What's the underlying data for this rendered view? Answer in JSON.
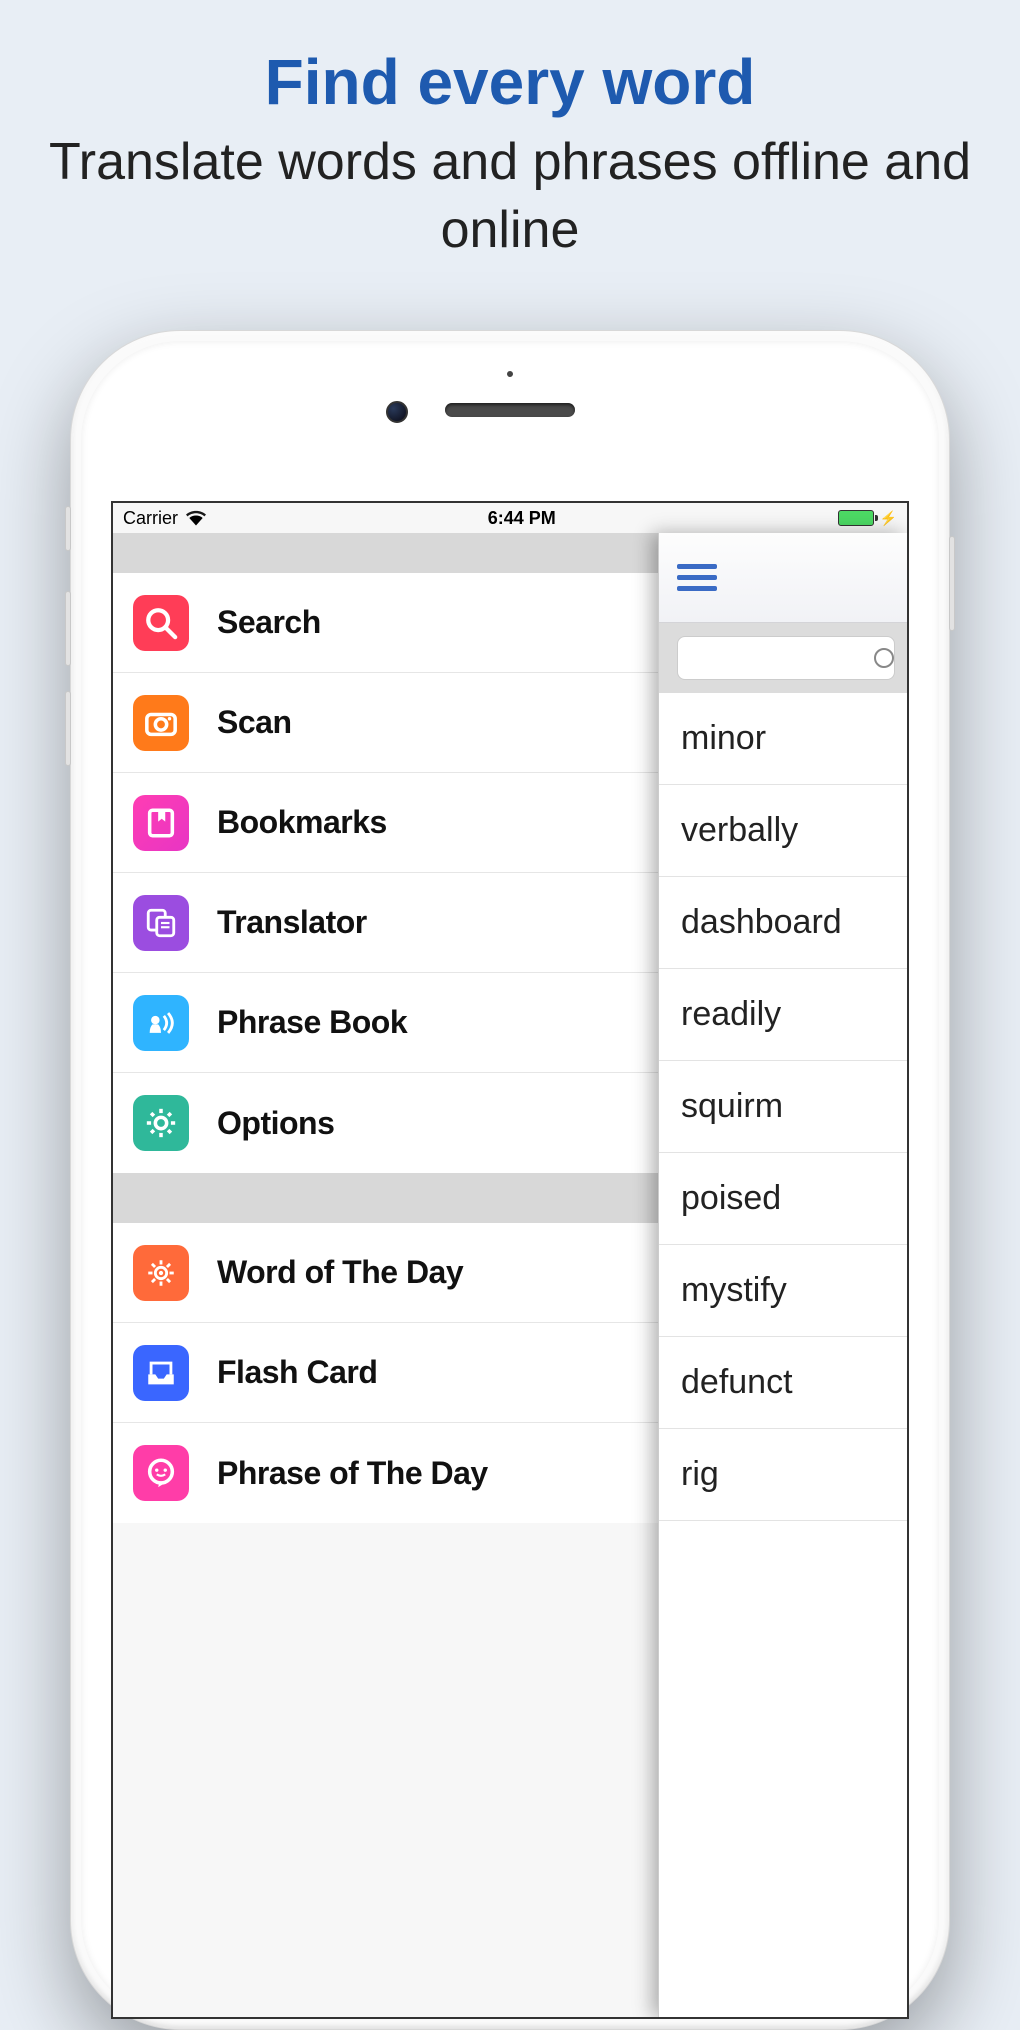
{
  "promo": {
    "title": "Find every word",
    "subtitle": "Translate words and phrases offline and online"
  },
  "status_bar": {
    "carrier": "Carrier",
    "time": "6:44 PM"
  },
  "sidebar": {
    "group1": [
      {
        "label": "Search",
        "icon": "search-icon"
      },
      {
        "label": "Scan",
        "icon": "camera-icon"
      },
      {
        "label": "Bookmarks",
        "icon": "bookmark-icon"
      },
      {
        "label": "Translator",
        "icon": "document-icon"
      },
      {
        "label": "Phrase Book",
        "icon": "speak-icon"
      },
      {
        "label": "Options",
        "icon": "gear-icon"
      }
    ],
    "group2": [
      {
        "label": "Word of The Day",
        "icon": "sun-icon"
      },
      {
        "label": "Flash Card",
        "icon": "tray-icon"
      },
      {
        "label": "Phrase of The Day",
        "icon": "chat-icon"
      }
    ]
  },
  "word_list": [
    "minor",
    "verbally",
    "dashboard",
    "readily",
    "squirm",
    "poised",
    "mystify",
    "defunct",
    "rig"
  ]
}
